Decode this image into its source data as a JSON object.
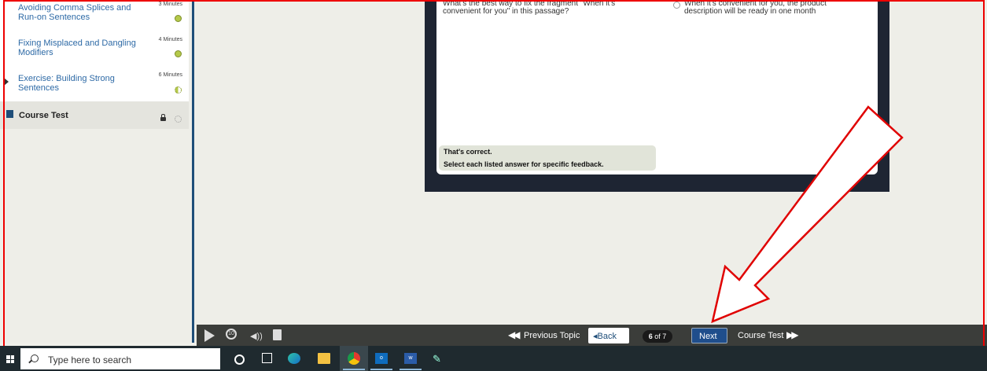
{
  "sidebar": {
    "items": [
      {
        "label": "Avoiding Comma Splices and Run-on Sentences",
        "duration": "3 Minutes",
        "status": "complete"
      },
      {
        "label": "Fixing Misplaced and Dangling Modifiers",
        "duration": "4 Minutes",
        "status": "complete"
      },
      {
        "label": "Exercise: Building Strong Sentences",
        "duration": "6 Minutes",
        "status": "in-progress"
      }
    ],
    "course_test": {
      "label": "Course Test"
    }
  },
  "content": {
    "question": "What's the best way to fix the fragment \"When it's convenient for you\" in this passage?",
    "option": "When it's convenient for you, the product description will be ready in one month",
    "feedback_line1": "That's correct.",
    "feedback_line2": "Select each listed answer for specific feedback."
  },
  "player": {
    "previous_topic": "Previous Topic",
    "back": "Back",
    "page_current": "6",
    "page_sep": " of 7",
    "next": "Next",
    "course_test": "Course Test",
    "replay_label": "10"
  },
  "taskbar": {
    "search_placeholder": "Type here to search",
    "apps": [
      "cortana",
      "task-view",
      "edge",
      "file-explorer",
      "chrome",
      "outlook",
      "word",
      "paint"
    ]
  },
  "colors": {
    "accent": "#1f4e79",
    "annotation": "#e00000",
    "complete": "#b5c94a"
  }
}
